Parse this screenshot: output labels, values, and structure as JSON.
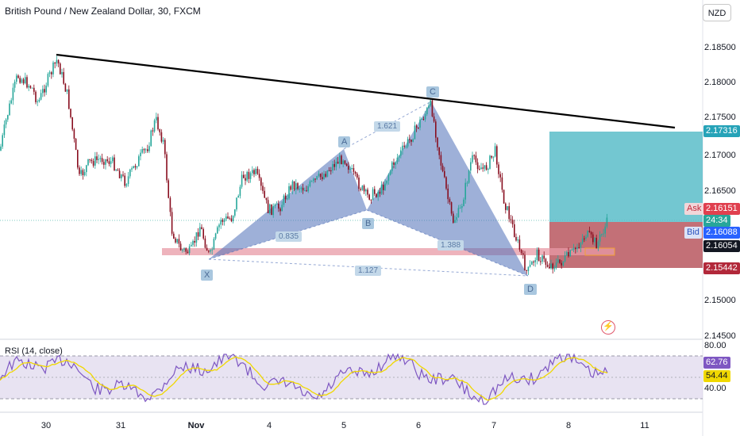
{
  "header": {
    "title": "British Pound / New Zealand Dollar, 30, FXCM",
    "currency": "NZD"
  },
  "price_axis": {
    "labels": [
      "2.18500",
      "2.18000",
      "2.17500",
      "2.17000",
      "2.16500",
      "2.15000",
      "2.14500"
    ]
  },
  "tags": {
    "target": "2.17316",
    "ask_label": "Ask",
    "ask": "2.16151",
    "countdown": "24:34",
    "bid_label": "Bid",
    "bid": "2.16088",
    "last": "2.16054",
    "stop": "2.15442"
  },
  "pattern": {
    "points": [
      "X",
      "A",
      "B",
      "C",
      "D"
    ],
    "ratios": [
      "0.835",
      "1.621",
      "1.127",
      "1.388"
    ]
  },
  "rsi": {
    "title": "RSI (14, close)",
    "axis": [
      "80.00",
      "40.00"
    ],
    "value": "62.76",
    "ma": "54.44"
  },
  "time_axis": {
    "labels": [
      "30",
      "31",
      "Nov",
      "4",
      "5",
      "6",
      "7",
      "8",
      "11"
    ]
  },
  "colors": {
    "candle_up": "#26a69a",
    "candle_down": "#880e1f",
    "pattern_fill": "#4f6fb8",
    "target_zone": "#5bbdc9",
    "stop_zone": "#b8575f",
    "support_zone": "#e89aa5",
    "rsi_line": "#7e57c2",
    "rsi_ma": "#f0d800"
  }
}
